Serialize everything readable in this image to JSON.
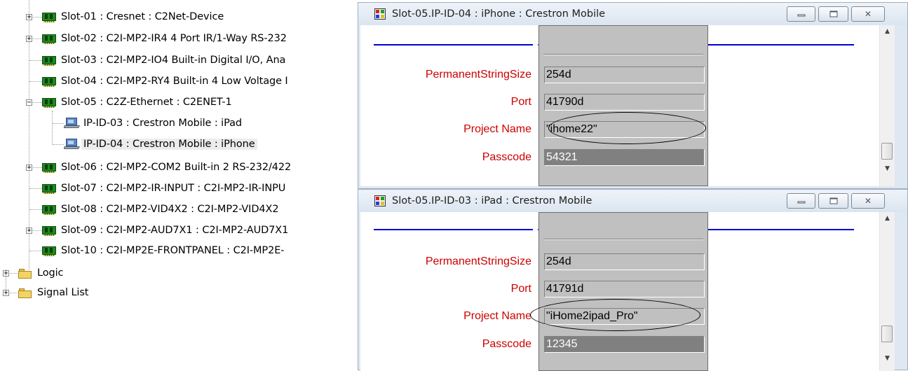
{
  "tree": {
    "slots": [
      {
        "label": "Slot-01 : Cresnet : C2Net-Device"
      },
      {
        "label": "Slot-02 : C2I-MP2-IR4 4 Port IR/1-Way RS-232"
      },
      {
        "label": "Slot-03 : C2I-MP2-IO4 Built-in Digital I/O, Ana"
      },
      {
        "label": "Slot-04 : C2I-MP2-RY4 Built-in 4 Low Voltage I"
      },
      {
        "label": "Slot-05 : C2Z-Ethernet : C2ENET-1"
      },
      {
        "label": "IP-ID-03 : Crestron Mobile : iPad"
      },
      {
        "label": "IP-ID-04 : Crestron Mobile : iPhone"
      },
      {
        "label": "Slot-06 : C2I-MP2-COM2 Built-in 2 RS-232/422"
      },
      {
        "label": "Slot-07 : C2I-MP2-IR-INPUT : C2I-MP2-IR-INPU"
      },
      {
        "label": "Slot-08 : C2I-MP2-VID4X2 : C2I-MP2-VID4X2"
      },
      {
        "label": "Slot-09 : C2I-MP2-AUD7X1 : C2I-MP2-AUD7X1"
      },
      {
        "label": "Slot-10 : C2I-MP2E-FRONTPANEL : C2I-MP2E-"
      }
    ],
    "folders": [
      {
        "label": "Logic"
      },
      {
        "label": "Signal List"
      }
    ],
    "expander_collapsed": "+",
    "expander_expanded": "−"
  },
  "windows": [
    {
      "title": "Slot-05.IP-ID-04 : iPhone : Crestron Mobile",
      "top_fragment_left": "...",
      "top_fragment_right": "...",
      "params": [
        {
          "label": "PermanentStringSize",
          "value": "254d"
        },
        {
          "label": "Port",
          "value": "41790d"
        },
        {
          "label": "Project Name",
          "value": "\"ihome22\""
        },
        {
          "label": "Passcode",
          "value": "54321"
        }
      ]
    },
    {
      "title": "Slot-05.IP-ID-03 : iPad : Crestron Mobile",
      "params": [
        {
          "label": "PermanentStringSize",
          "value": "254d"
        },
        {
          "label": "Port",
          "value": "41791d"
        },
        {
          "label": "Project Name",
          "value": "\"iHome2ipad_Pro\""
        },
        {
          "label": "Passcode",
          "value": "12345"
        }
      ]
    }
  ],
  "colors": {
    "param_label": "#cc0000",
    "signal_line": "#0000d6",
    "card_green": "#1d8a1d",
    "folder_yellow": "#f3d365"
  },
  "icons": {
    "slot": "circuit-card-icon",
    "device": "tablet-device-icon",
    "folder": "folder-icon",
    "window": "program-window-icon",
    "minimize": "minimize-icon",
    "maximize": "maximize-icon",
    "close": "close-icon"
  }
}
